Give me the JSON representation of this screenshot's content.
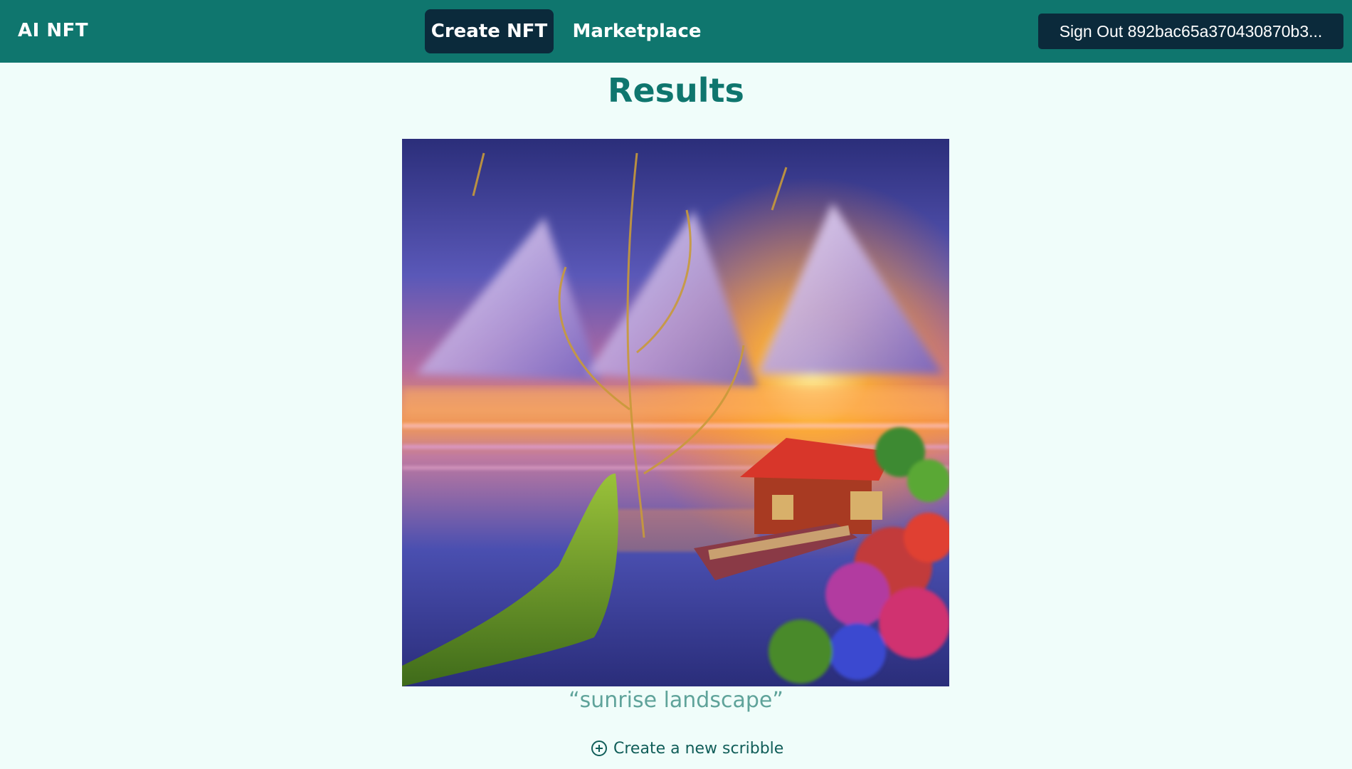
{
  "header": {
    "brand": "AI NFT",
    "tabs": [
      {
        "label": "Create NFT",
        "active": true
      },
      {
        "label": "Marketplace",
        "active": false
      }
    ],
    "sign_out_label": "Sign Out 892bac65a370430870b3..."
  },
  "main": {
    "title": "Results",
    "image_alt": "sunrise landscape",
    "caption": "“sunrise landscape”",
    "new_scribble": {
      "label": "Create a new scribble",
      "icon": "plus-circle-icon"
    }
  },
  "colors": {
    "navbar": "#0f766e",
    "active_tab": "#0b2a3b",
    "page_bg": "#f0fdfa",
    "title": "#0f766e",
    "caption": "#5fa39a"
  }
}
